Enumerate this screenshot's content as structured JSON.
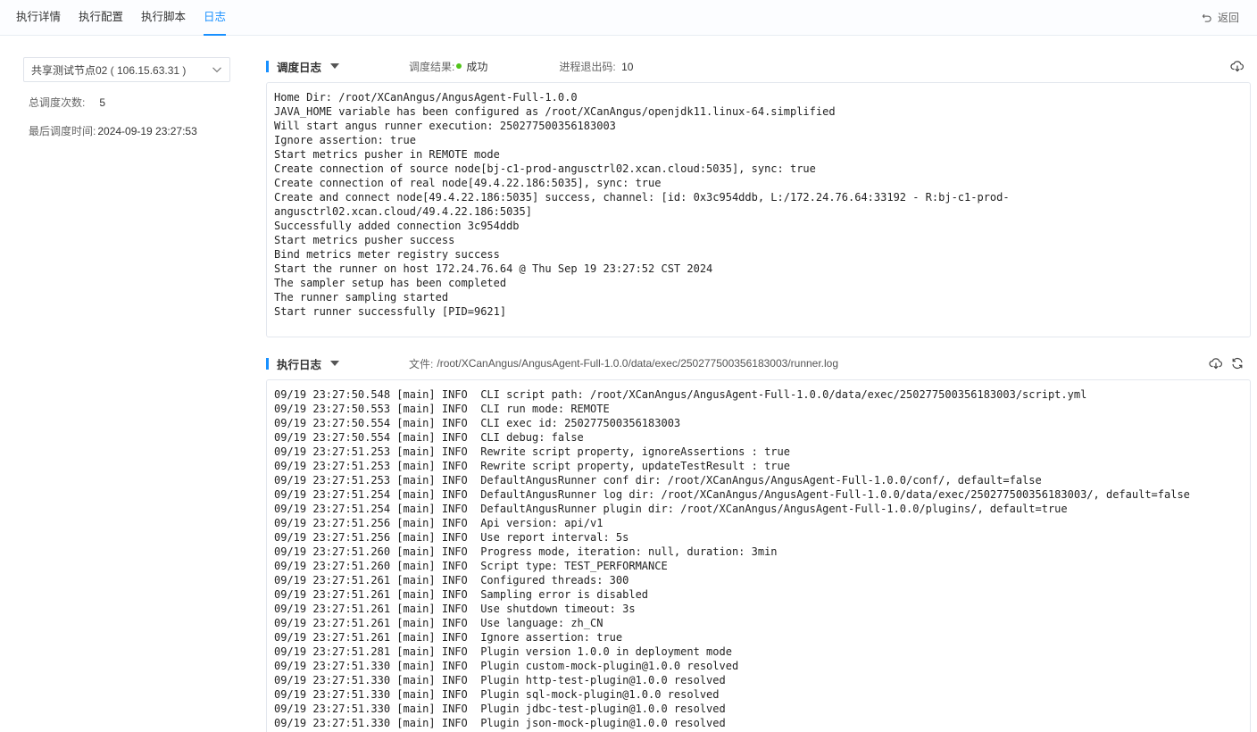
{
  "tabs": [
    {
      "label": "执行详情"
    },
    {
      "label": "执行配置"
    },
    {
      "label": "执行脚本"
    },
    {
      "label": "日志"
    }
  ],
  "back_label": "返回",
  "node_select": {
    "value": "共享测试节点02 ( 106.15.63.31 )"
  },
  "stats": {
    "total_label": "总调度次数:",
    "total_value": "5",
    "last_label": "最后调度时间:",
    "last_value": "2024-09-19 23:27:53"
  },
  "schedule_log": {
    "title": "调度日志",
    "result_label": "调度结果:",
    "result_value": "成功",
    "exit_label": "进程退出码:",
    "exit_value": "10",
    "lines": [
      "Home Dir: /root/XCanAngus/AngusAgent-Full-1.0.0",
      "JAVA_HOME variable has been configured as /root/XCanAngus/openjdk11.linux-64.simplified",
      "Will start angus runner execution: 250277500356183003",
      "Ignore assertion: true",
      "Start metrics pusher in REMOTE mode",
      "Create connection of source node[bj-c1-prod-angusctrl02.xcan.cloud:5035], sync: true",
      "Create connection of real node[49.4.22.186:5035], sync: true",
      "Create and connect node[49.4.22.186:5035] success, channel: [id: 0x3c954ddb, L:/172.24.76.64:33192 - R:bj-c1-prod-",
      "angusctrl02.xcan.cloud/49.4.22.186:5035]",
      "Successfully added connection 3c954ddb",
      "Start metrics pusher success",
      "Bind metrics meter registry success",
      "Start the runner on host 172.24.76.64 @ Thu Sep 19 23:27:52 CST 2024",
      "The sampler setup has been completed",
      "The runner sampling started",
      "Start runner successfully [PID=9621]"
    ]
  },
  "exec_log": {
    "title": "执行日志",
    "file_label": "文件:",
    "file_value": "/root/XCanAngus/AngusAgent-Full-1.0.0/data/exec/250277500356183003/runner.log",
    "lines": [
      "09/19 23:27:50.548 [main] INFO  CLI script path: /root/XCanAngus/AngusAgent-Full-1.0.0/data/exec/250277500356183003/script.yml",
      "09/19 23:27:50.553 [main] INFO  CLI run mode: REMOTE",
      "09/19 23:27:50.554 [main] INFO  CLI exec id: 250277500356183003",
      "09/19 23:27:50.554 [main] INFO  CLI debug: false",
      "09/19 23:27:51.253 [main] INFO  Rewrite script property, ignoreAssertions : true",
      "09/19 23:27:51.253 [main] INFO  Rewrite script property, updateTestResult : true",
      "09/19 23:27:51.253 [main] INFO  DefaultAngusRunner conf dir: /root/XCanAngus/AngusAgent-Full-1.0.0/conf/, default=false",
      "09/19 23:27:51.254 [main] INFO  DefaultAngusRunner log dir: /root/XCanAngus/AngusAgent-Full-1.0.0/data/exec/250277500356183003/, default=false",
      "09/19 23:27:51.254 [main] INFO  DefaultAngusRunner plugin dir: /root/XCanAngus/AngusAgent-Full-1.0.0/plugins/, default=true",
      "09/19 23:27:51.256 [main] INFO  Api version: api/v1",
      "09/19 23:27:51.256 [main] INFO  Use report interval: 5s",
      "09/19 23:27:51.260 [main] INFO  Progress mode, iteration: null, duration: 3min",
      "09/19 23:27:51.260 [main] INFO  Script type: TEST_PERFORMANCE",
      "09/19 23:27:51.261 [main] INFO  Configured threads: 300",
      "09/19 23:27:51.261 [main] INFO  Sampling error is disabled",
      "09/19 23:27:51.261 [main] INFO  Use shutdown timeout: 3s",
      "09/19 23:27:51.261 [main] INFO  Use language: zh_CN",
      "09/19 23:27:51.261 [main] INFO  Ignore assertion: true",
      "09/19 23:27:51.281 [main] INFO  Plugin version 1.0.0 in deployment mode",
      "09/19 23:27:51.330 [main] INFO  Plugin custom-mock-plugin@1.0.0 resolved",
      "09/19 23:27:51.330 [main] INFO  Plugin http-test-plugin@1.0.0 resolved",
      "09/19 23:27:51.330 [main] INFO  Plugin sql-mock-plugin@1.0.0 resolved",
      "09/19 23:27:51.330 [main] INFO  Plugin jdbc-test-plugin@1.0.0 resolved",
      "09/19 23:27:51.330 [main] INFO  Plugin json-mock-plugin@1.0.0 resolved"
    ]
  },
  "colors": {
    "accent": "#1890ff",
    "success": "#52c41a"
  }
}
